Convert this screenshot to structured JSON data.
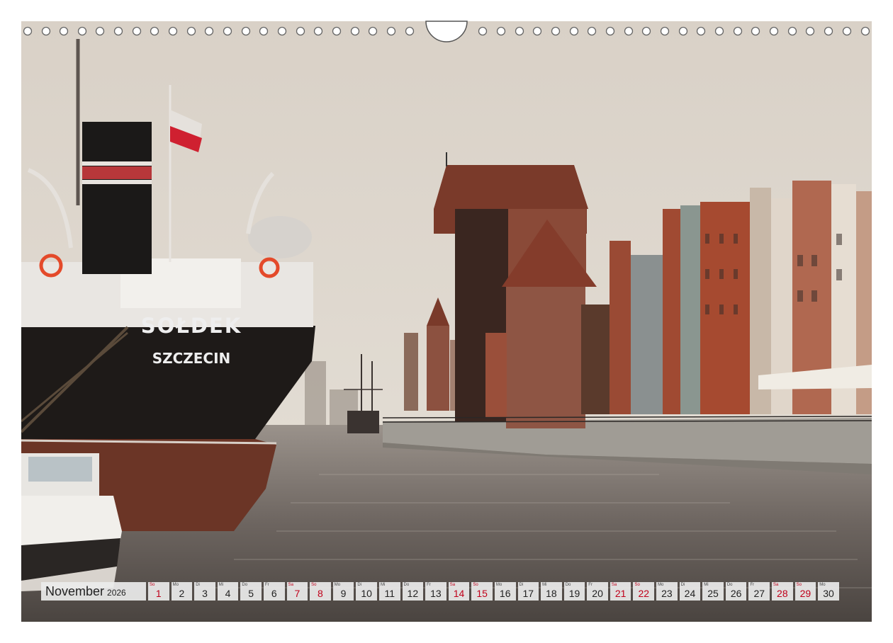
{
  "ship": {
    "name": "SOŁDEK",
    "port": "SZCZECIN"
  },
  "calendar": {
    "month": "November",
    "year": "2026",
    "days": [
      {
        "abbr": "So",
        "num": "1",
        "weekend": true
      },
      {
        "abbr": "Mo",
        "num": "2",
        "weekend": false
      },
      {
        "abbr": "Di",
        "num": "3",
        "weekend": false
      },
      {
        "abbr": "Mi",
        "num": "4",
        "weekend": false
      },
      {
        "abbr": "Do",
        "num": "5",
        "weekend": false
      },
      {
        "abbr": "Fr",
        "num": "6",
        "weekend": false
      },
      {
        "abbr": "Sa",
        "num": "7",
        "weekend": true
      },
      {
        "abbr": "So",
        "num": "8",
        "weekend": true
      },
      {
        "abbr": "Mo",
        "num": "9",
        "weekend": false
      },
      {
        "abbr": "Di",
        "num": "10",
        "weekend": false
      },
      {
        "abbr": "Mi",
        "num": "11",
        "weekend": false
      },
      {
        "abbr": "Do",
        "num": "12",
        "weekend": false
      },
      {
        "abbr": "Fr",
        "num": "13",
        "weekend": false
      },
      {
        "abbr": "Sa",
        "num": "14",
        "weekend": true
      },
      {
        "abbr": "So",
        "num": "15",
        "weekend": true
      },
      {
        "abbr": "Mo",
        "num": "16",
        "weekend": false
      },
      {
        "abbr": "Di",
        "num": "17",
        "weekend": false
      },
      {
        "abbr": "Mi",
        "num": "18",
        "weekend": false
      },
      {
        "abbr": "Do",
        "num": "19",
        "weekend": false
      },
      {
        "abbr": "Fr",
        "num": "20",
        "weekend": false
      },
      {
        "abbr": "Sa",
        "num": "21",
        "weekend": true
      },
      {
        "abbr": "So",
        "num": "22",
        "weekend": true
      },
      {
        "abbr": "Mo",
        "num": "23",
        "weekend": false
      },
      {
        "abbr": "Di",
        "num": "24",
        "weekend": false
      },
      {
        "abbr": "Mi",
        "num": "25",
        "weekend": false
      },
      {
        "abbr": "Do",
        "num": "26",
        "weekend": false
      },
      {
        "abbr": "Fr",
        "num": "27",
        "weekend": false
      },
      {
        "abbr": "Sa",
        "num": "28",
        "weekend": true
      },
      {
        "abbr": "So",
        "num": "29",
        "weekend": true
      },
      {
        "abbr": "Mo",
        "num": "30",
        "weekend": false
      }
    ]
  },
  "colors": {
    "weekend": "#c0001a",
    "hull": "#1e1a18",
    "hull_lower": "#6b3526",
    "brick": "#8a4a38",
    "sky": "#dcd5cc",
    "water": "#7d7570"
  }
}
